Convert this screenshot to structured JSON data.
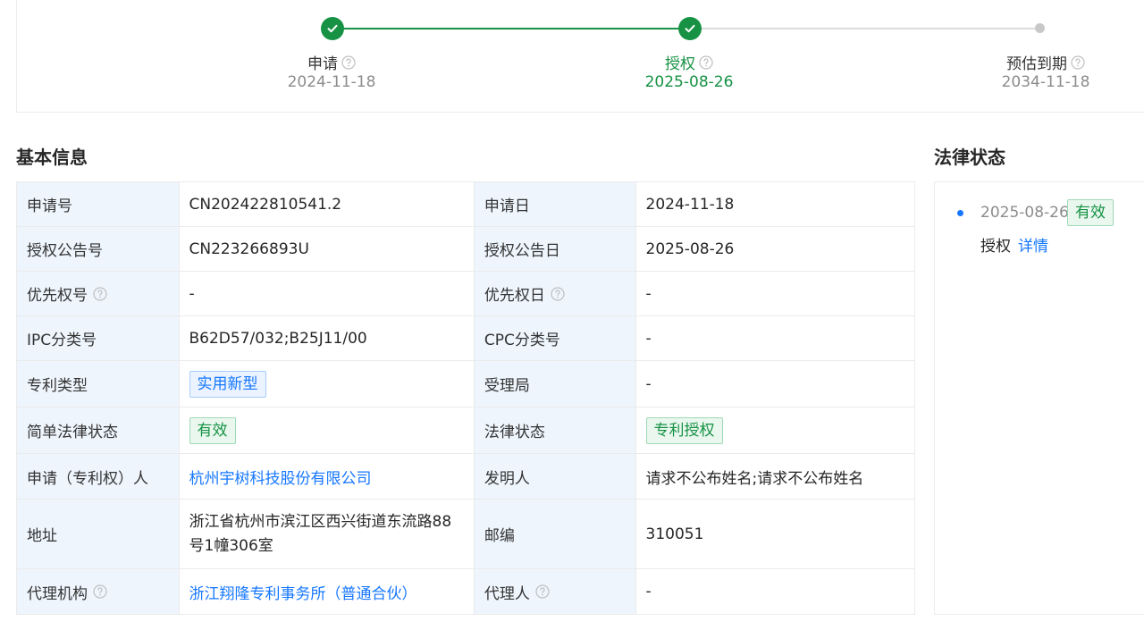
{
  "timeline": {
    "steps": [
      {
        "label": "申请",
        "date": "2024-11-18",
        "status": "done"
      },
      {
        "label": "授权",
        "date": "2025-08-26",
        "status": "current"
      },
      {
        "label": "预估到期",
        "date": "2034-11-18",
        "status": "pending"
      }
    ]
  },
  "basic_info": {
    "title": "基本信息",
    "rows": [
      {
        "l1": "申请号",
        "v1": "CN202422810541.2",
        "l2": "申请日",
        "v2": "2024-11-18"
      },
      {
        "l1": "授权公告号",
        "v1": "CN223266893U",
        "l2": "授权公告日",
        "v2": "2025-08-26"
      },
      {
        "l1": "优先权号",
        "v1": "-",
        "l2": "优先权日",
        "v2": "-"
      },
      {
        "l1": "IPC分类号",
        "v1": "B62D57/032;B25J11/00",
        "l2": "CPC分类号",
        "v2": "-"
      },
      {
        "l1": "专利类型",
        "v1": "实用新型",
        "l2": "受理局",
        "v2": "-"
      },
      {
        "l1": "简单法律状态",
        "v1": "有效",
        "l2": "法律状态",
        "v2": "专利授权"
      },
      {
        "l1": "申请（专利权）人",
        "v1": "杭州宇树科技股份有限公司",
        "l2": "发明人",
        "v2": "请求不公布姓名;请求不公布姓名"
      },
      {
        "l1": "地址",
        "v1": "浙江省杭州市滨江区西兴街道东流路88号1幢306室",
        "l2": "邮编",
        "v2": "310051"
      },
      {
        "l1": "代理机构",
        "v1": "浙江翔隆专利事务所（普通合伙）",
        "l2": "代理人",
        "v2": "-"
      }
    ]
  },
  "legal_status": {
    "title": "法律状态",
    "entries": [
      {
        "date": "2025-08-26",
        "badge": "有效",
        "event": "授权",
        "link": "详情"
      }
    ]
  },
  "colors": {
    "accent_green": "#179245",
    "accent_blue": "#1677ff",
    "label_bg": "#eef5fd"
  },
  "icons": [
    "check-icon",
    "question-circle-icon",
    "timeline-dot-icon"
  ]
}
